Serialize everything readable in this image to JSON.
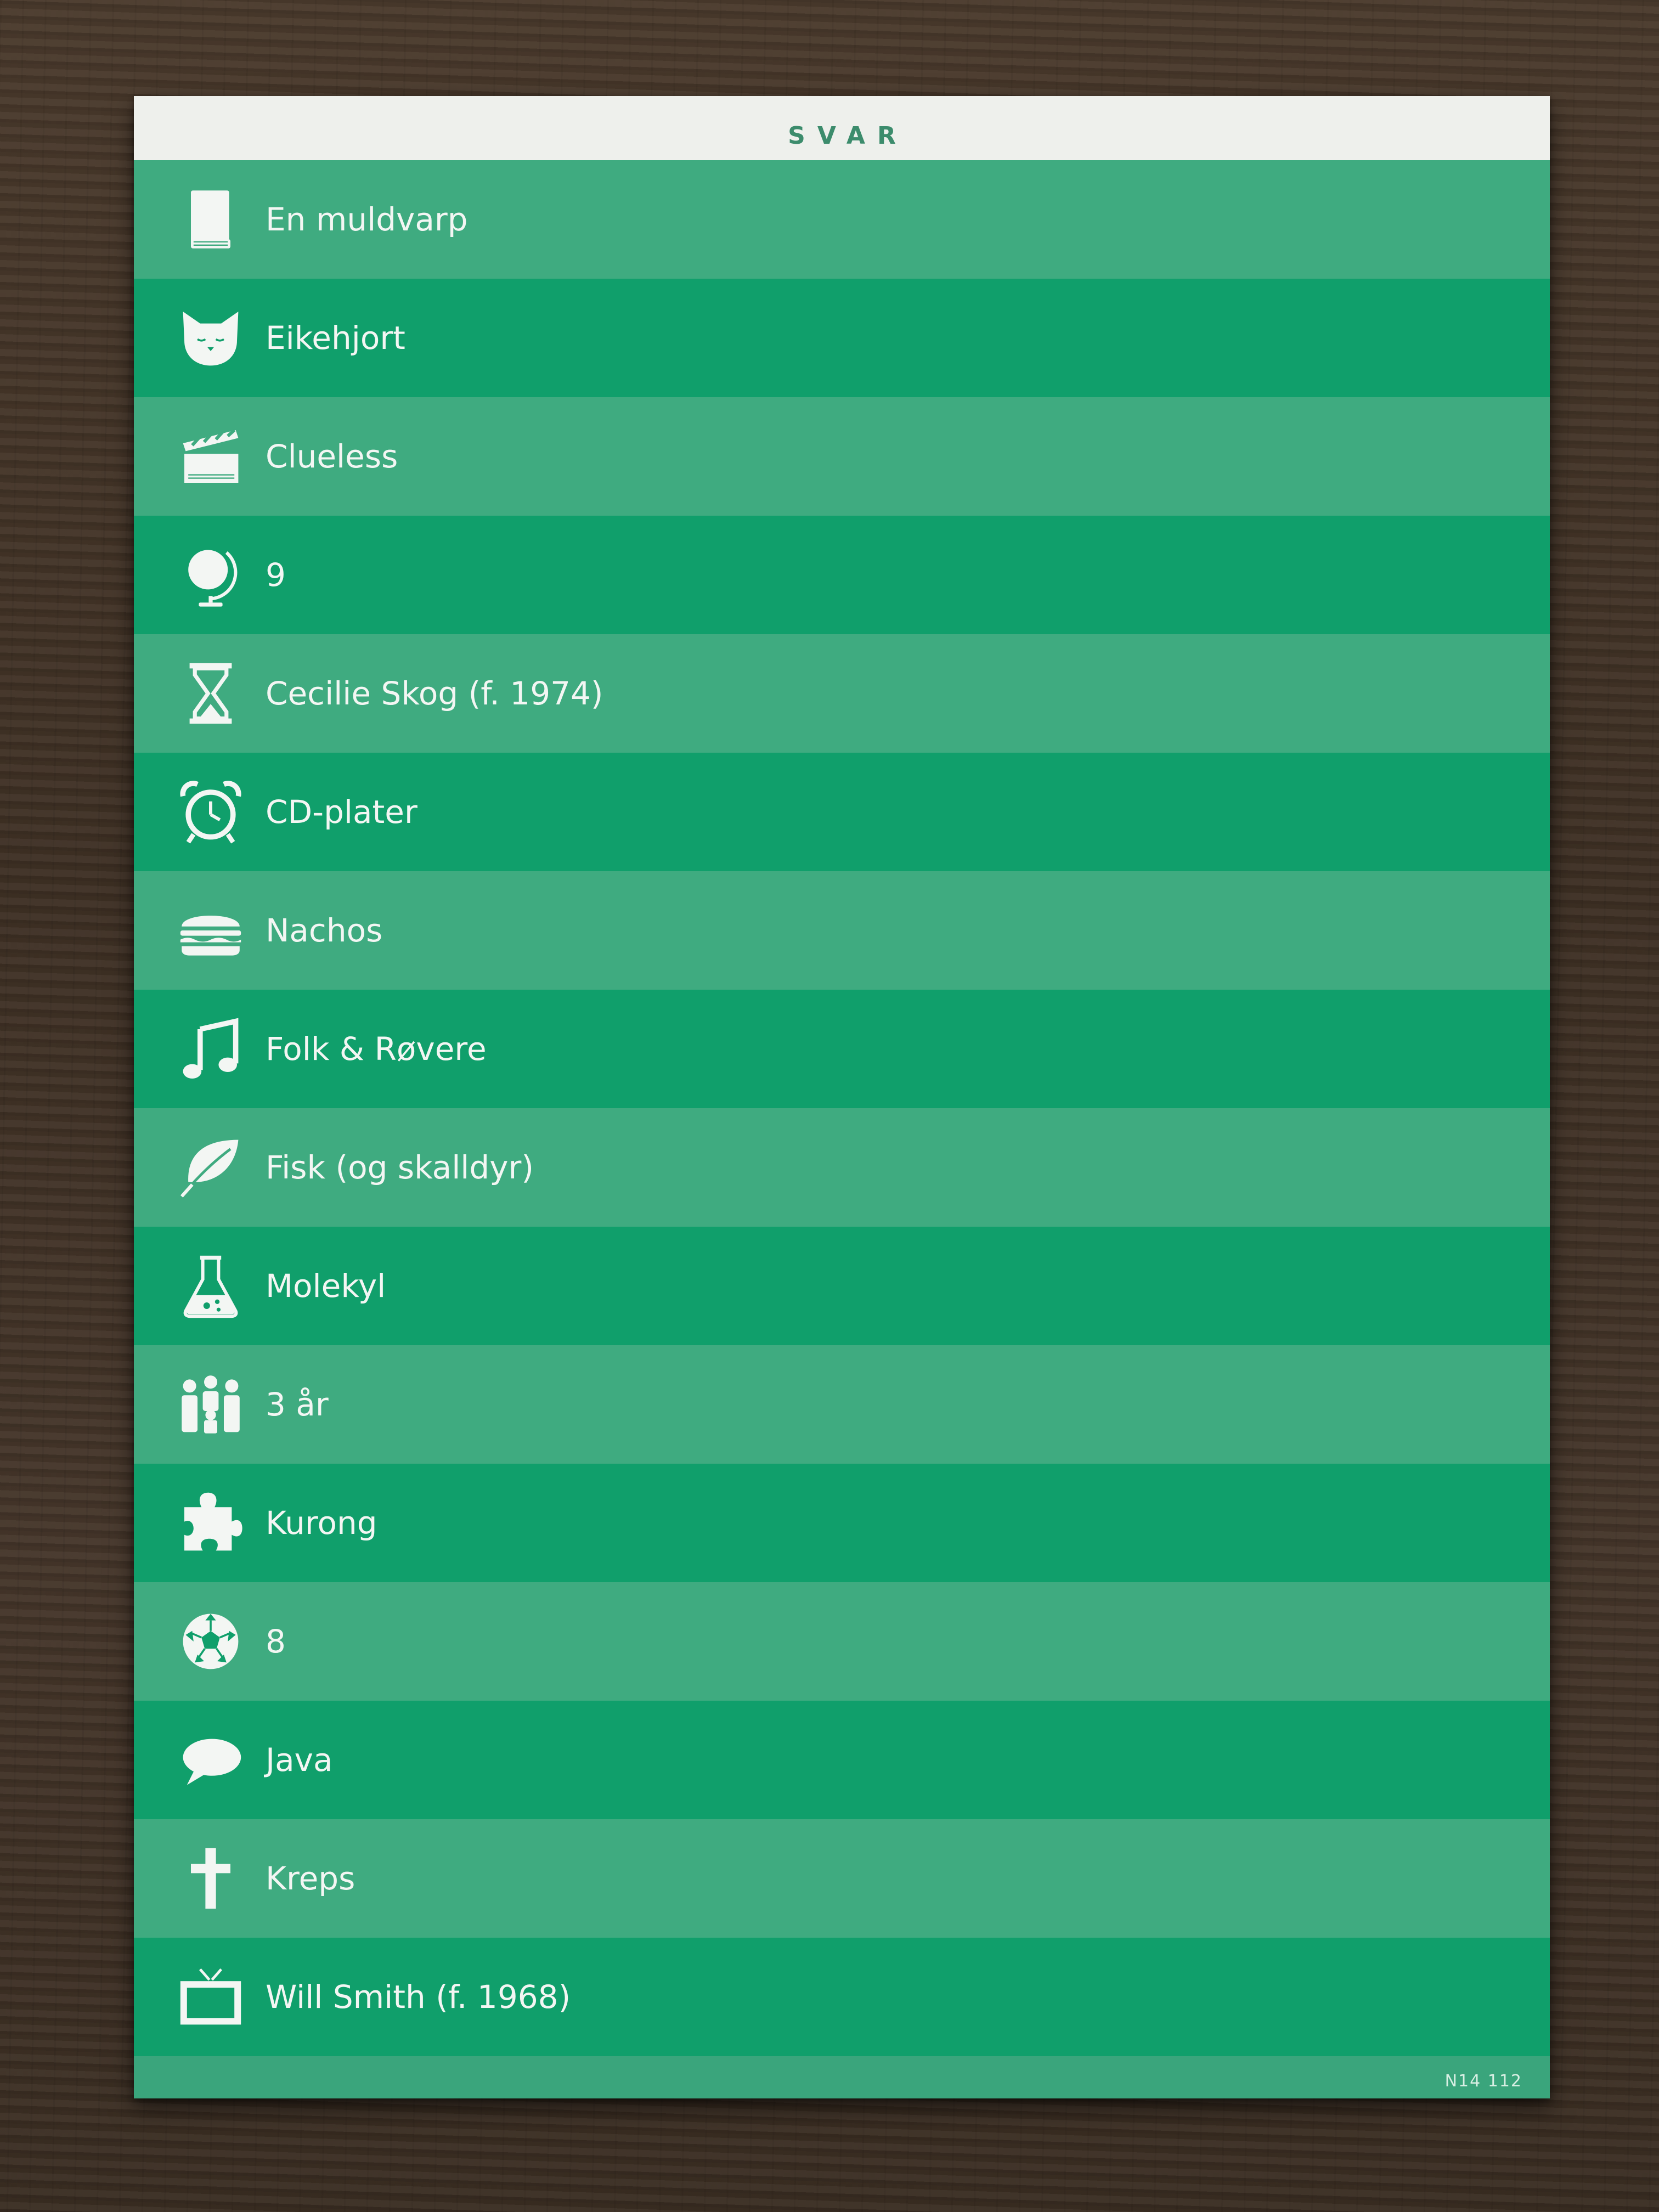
{
  "card": {
    "title": "SVAR",
    "code": "N14 112",
    "background": "#3aa57c",
    "header_background": "#eef0ec",
    "stripe_light": "#3fab80",
    "stripe_dark": "#109f6b",
    "text_color": "#f3f6f3"
  },
  "answers": [
    {
      "icon": "book-icon",
      "text": "En muldvarp"
    },
    {
      "icon": "cat-icon",
      "text": "Eikehjort"
    },
    {
      "icon": "clapperboard-icon",
      "text": "Clueless"
    },
    {
      "icon": "globe-icon",
      "text": "9"
    },
    {
      "icon": "hourglass-icon",
      "text": "Cecilie Skog (f. 1974)"
    },
    {
      "icon": "alarm-clock-icon",
      "text": "CD-plater"
    },
    {
      "icon": "burger-icon",
      "text": "Nachos"
    },
    {
      "icon": "music-note-icon",
      "text": "Folk & Røvere"
    },
    {
      "icon": "leaf-icon",
      "text": "Fisk (og skalldyr)"
    },
    {
      "icon": "flask-icon",
      "text": "Molekyl"
    },
    {
      "icon": "family-icon",
      "text": "3 år"
    },
    {
      "icon": "puzzle-piece-icon",
      "text": "Kurong"
    },
    {
      "icon": "soccer-ball-icon",
      "text": "8"
    },
    {
      "icon": "speech-bubble-icon",
      "text": "Java"
    },
    {
      "icon": "cross-icon",
      "text": "Kreps"
    },
    {
      "icon": "tv-icon",
      "text": "Will Smith (f. 1968)"
    }
  ]
}
